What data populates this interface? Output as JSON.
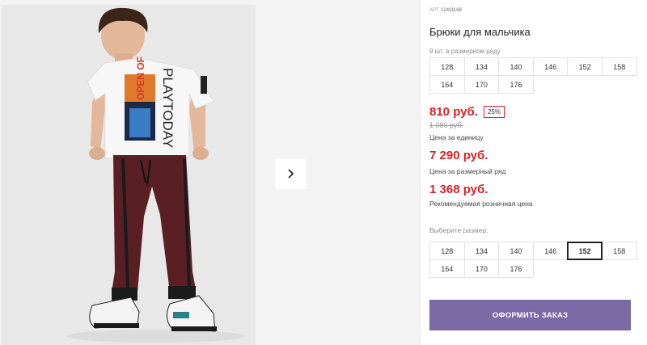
{
  "gallery": {
    "photo_alt": "boy-in-tshirt-and-joggers",
    "next_arrow_icon": "chevron-right-icon",
    "tshirt_print": "PLAYTODAY",
    "tshirt_print_overlay": "OPEN OF"
  },
  "product": {
    "sku_prefix": "АРТ.",
    "sku_value": "12411168",
    "title": "Брюки для мальчика",
    "pack_note": "9 шт. в размерном ряду"
  },
  "pack_sizes": [
    "128",
    "134",
    "140",
    "146",
    "152",
    "158",
    "164",
    "170",
    "176"
  ],
  "pricing": {
    "price": "810 руб.",
    "discount": "25%",
    "old_price": "1 080 руб.",
    "unit_caption": "Цена за единицу",
    "pack_price": "7 290 руб.",
    "pack_caption": "Цена за размерный ряд",
    "rrp_price": "1 368 руб.",
    "rrp_caption": "Рекомендуемая розничная цена"
  },
  "size_select": {
    "label": "Выберите размер:",
    "sizes": [
      "128",
      "134",
      "140",
      "146",
      "152",
      "158",
      "164",
      "170",
      "176"
    ],
    "selected": "152"
  },
  "order_button": "ОФОРМИТЬ ЗАКАЗ",
  "colors": {
    "accent_red": "#d8232a",
    "button_purple": "#7a6aa6"
  }
}
